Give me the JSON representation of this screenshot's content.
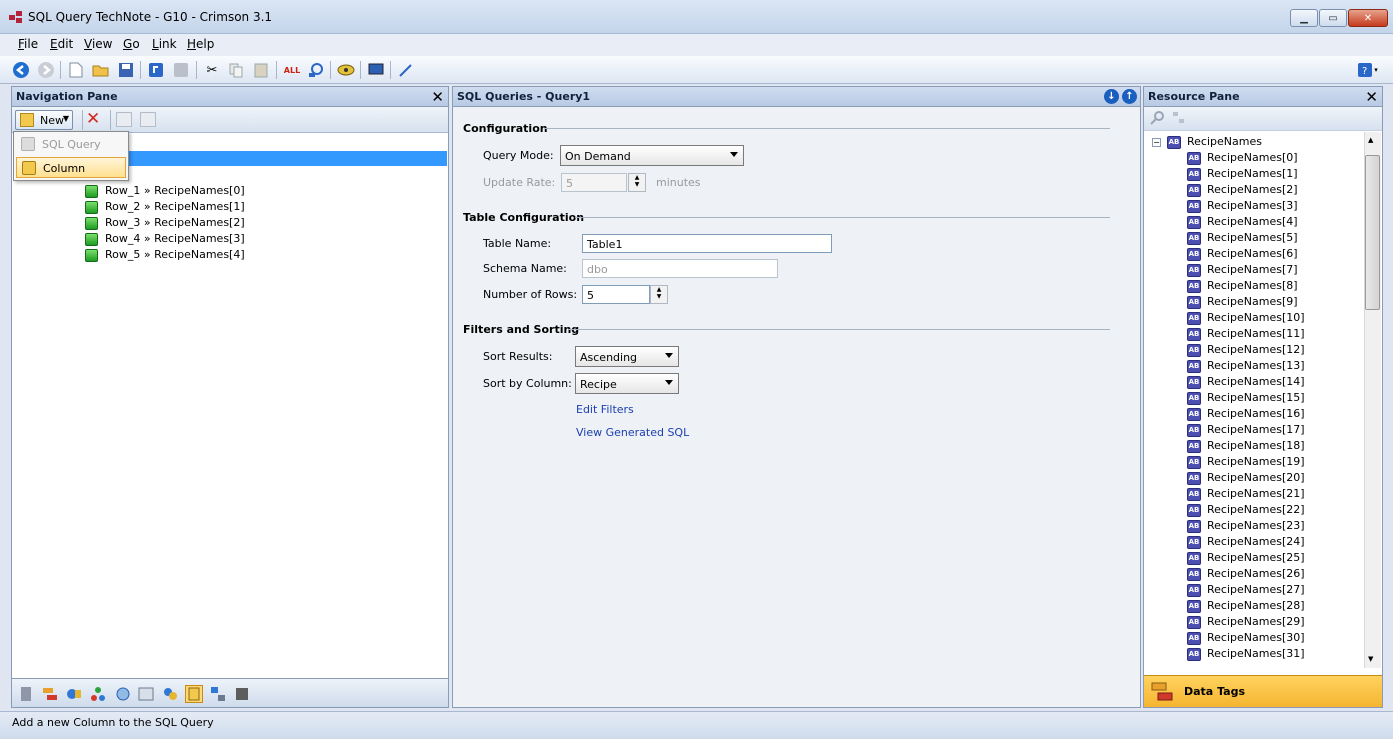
{
  "window": {
    "title": "SQL Query TechNote - G10 - Crimson 3.1"
  },
  "menu": [
    {
      "label": "File",
      "key": "F",
      "rest": "ile"
    },
    {
      "label": "Edit",
      "key": "E",
      "rest": "dit"
    },
    {
      "label": "View",
      "key": "V",
      "rest": "iew"
    },
    {
      "label": "Go",
      "key": "G",
      "rest": "o"
    },
    {
      "label": "Link",
      "key": "L",
      "rest": "ink"
    },
    {
      "label": "Help",
      "key": "H",
      "rest": "elp"
    }
  ],
  "toolbar": {
    "icons": [
      "back-icon",
      "forward-icon",
      "new-file-icon",
      "open-folder-icon",
      "save-icon",
      "undo-icon",
      "redo-icon",
      "cut-icon",
      "copy-icon",
      "paste-icon",
      "spellcheck-icon",
      "find-icon",
      "link-icon",
      "monitor-icon",
      "wand-icon"
    ],
    "help_icon": "help-icon"
  },
  "nav": {
    "title": "Navigation Pane",
    "new_label": "New",
    "popup": {
      "sql_query": "SQL Query",
      "column": "Column"
    },
    "rows": [
      "Row_1 » RecipeNames[0]",
      "Row_2 » RecipeNames[1]",
      "Row_3 » RecipeNames[2]",
      "Row_4 » RecipeNames[3]",
      "Row_5 » RecipeNames[4]"
    ]
  },
  "center": {
    "title": "SQL Queries - Query1",
    "configuration": {
      "heading": "Configuration",
      "query_mode_label": "Query Mode:",
      "query_mode_value": "On Demand",
      "update_rate_label": "Update Rate:",
      "update_rate_value": "5",
      "update_rate_unit": "minutes"
    },
    "table": {
      "heading": "Table Configuration",
      "table_name_label": "Table Name:",
      "table_name_value": "Table1",
      "schema_name_label": "Schema Name:",
      "schema_name_value": "dbo",
      "rows_label": "Number of Rows:",
      "rows_value": "5"
    },
    "filters": {
      "heading": "Filters and Sorting",
      "sort_results_label": "Sort Results:",
      "sort_results_value": "Ascending",
      "sort_column_label": "Sort by Column:",
      "sort_column_value": "Recipe",
      "edit_filters": "Edit Filters",
      "view_sql": "View Generated SQL"
    }
  },
  "resource": {
    "title": "Resource Pane",
    "root": "RecipeNames",
    "items": [
      "RecipeNames[0]",
      "RecipeNames[1]",
      "RecipeNames[2]",
      "RecipeNames[3]",
      "RecipeNames[4]",
      "RecipeNames[5]",
      "RecipeNames[6]",
      "RecipeNames[7]",
      "RecipeNames[8]",
      "RecipeNames[9]",
      "RecipeNames[10]",
      "RecipeNames[11]",
      "RecipeNames[12]",
      "RecipeNames[13]",
      "RecipeNames[14]",
      "RecipeNames[15]",
      "RecipeNames[16]",
      "RecipeNames[17]",
      "RecipeNames[18]",
      "RecipeNames[19]",
      "RecipeNames[20]",
      "RecipeNames[21]",
      "RecipeNames[22]",
      "RecipeNames[23]",
      "RecipeNames[24]",
      "RecipeNames[25]",
      "RecipeNames[26]",
      "RecipeNames[27]",
      "RecipeNames[28]",
      "RecipeNames[29]",
      "RecipeNames[30]",
      "RecipeNames[31]"
    ],
    "data_tags": "Data Tags"
  },
  "status": {
    "text": "Add a new Column to the SQL Query"
  }
}
